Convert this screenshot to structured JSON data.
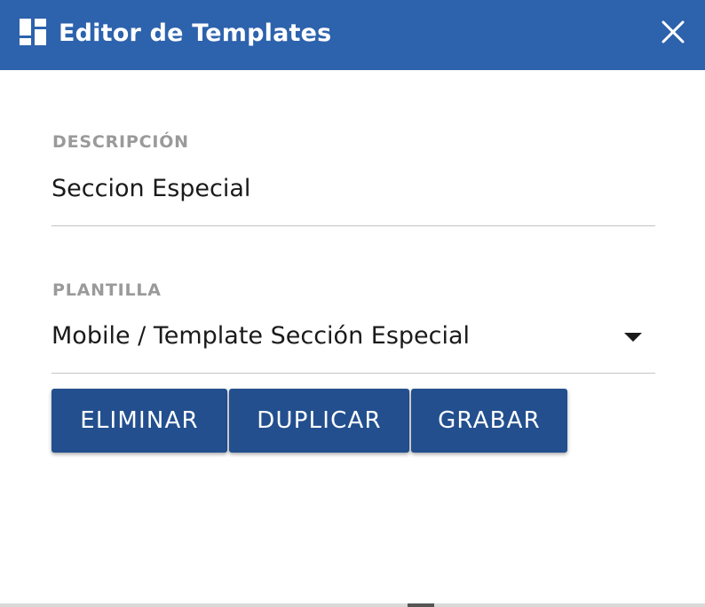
{
  "window": {
    "title": "Editor de Templates",
    "icon": "dashboard-grid-icon",
    "close_icon": "close-icon"
  },
  "form": {
    "description": {
      "label": "DESCRIPCIÓN",
      "value": "Seccion Especial"
    },
    "template": {
      "label": "PLANTILLA",
      "selected": "Mobile / Template Sección Especial",
      "dropdown_icon": "caret-down-icon"
    }
  },
  "actions": {
    "delete_label": "ELIMINAR",
    "duplicate_label": "DUPLICAR",
    "save_label": "GRABAR"
  },
  "colors": {
    "header": "#2d62ad",
    "button": "#234f8e",
    "label": "#9a9a9a",
    "text": "#1a1a1a"
  }
}
